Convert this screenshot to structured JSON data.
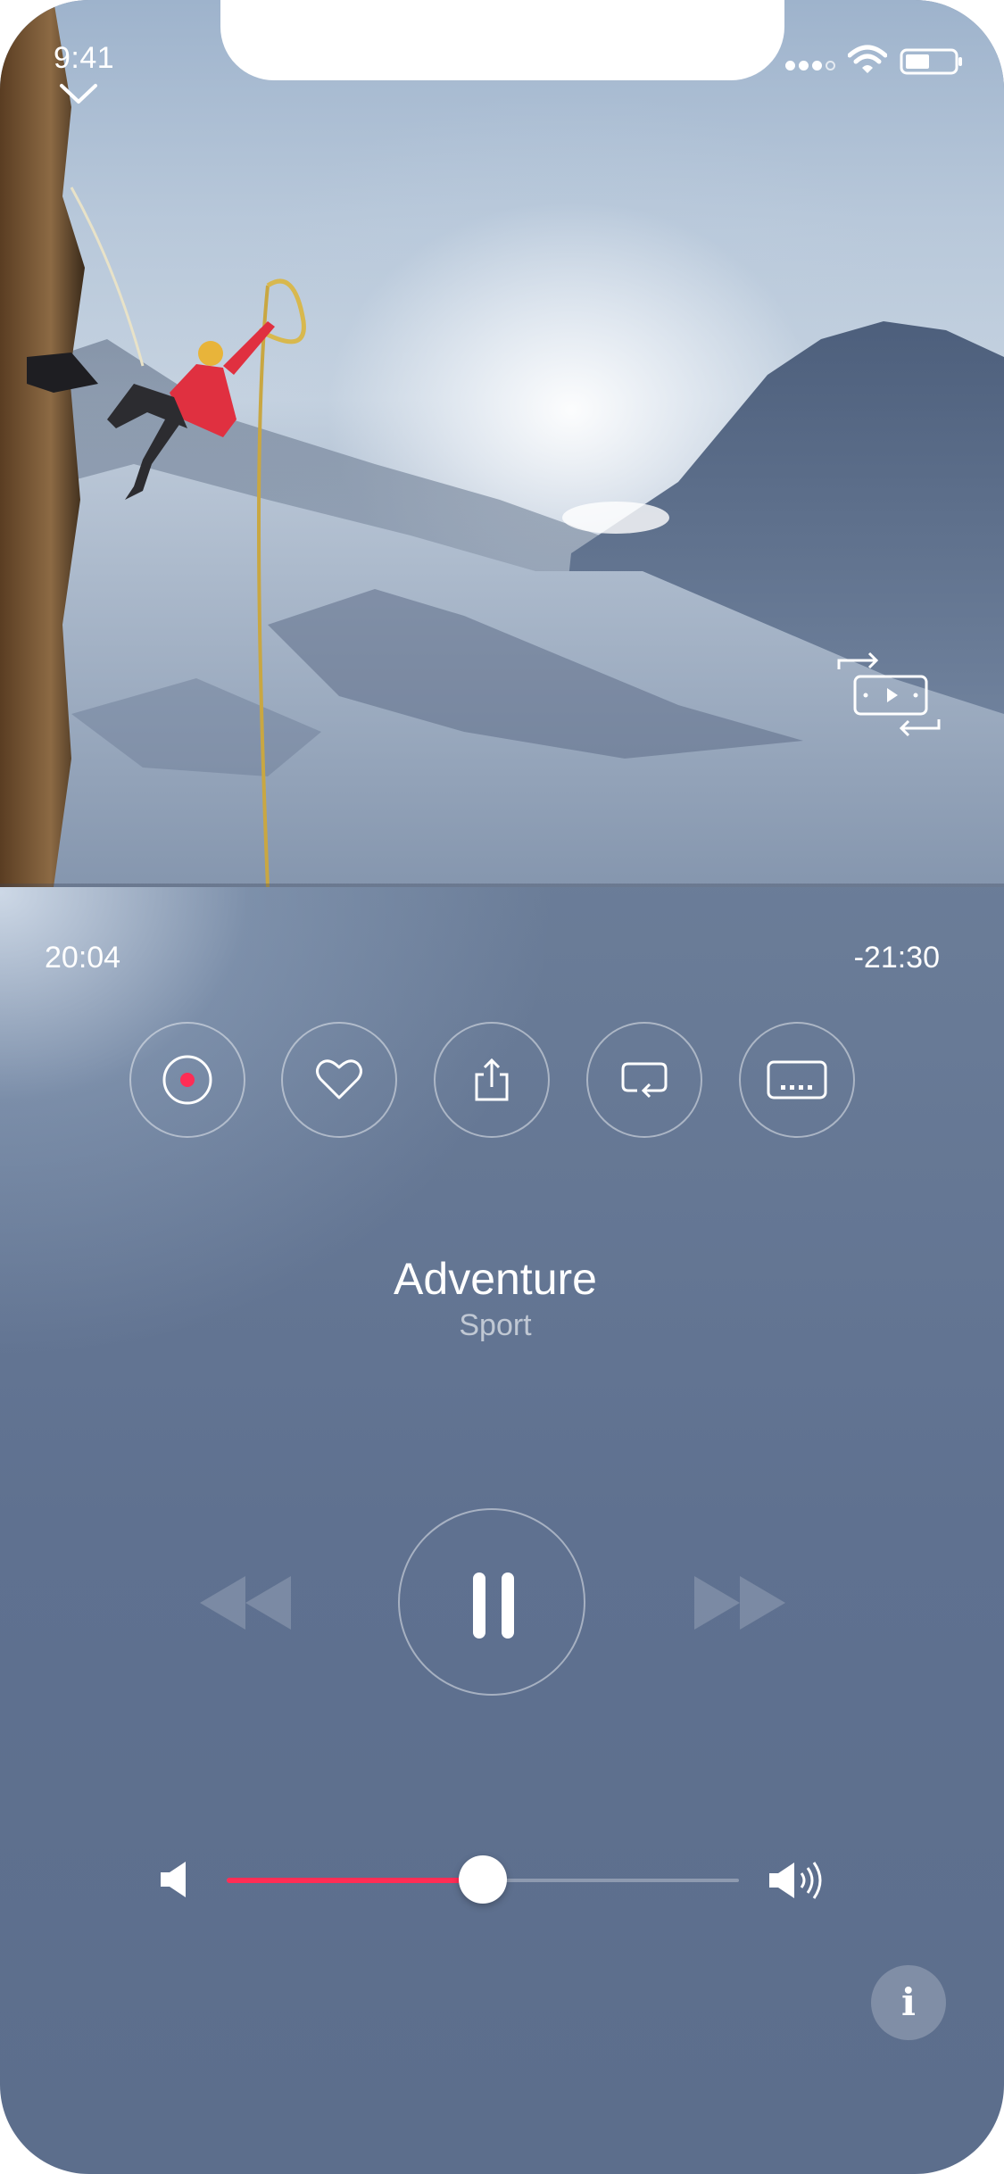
{
  "status_bar": {
    "time": "9:41",
    "icons": [
      "signal-icon",
      "wifi-icon",
      "battery-icon"
    ]
  },
  "video": {
    "image_description_icon": "climber-scene",
    "controls": [
      "collapse-chevron-icon",
      "picture-in-picture-icon"
    ]
  },
  "playback": {
    "elapsed": "20:04",
    "remaining": "-21:30",
    "volume_fraction": 0.5
  },
  "actions": [
    {
      "name": "record-button",
      "icon": "record-icon"
    },
    {
      "name": "like-button",
      "icon": "heart-icon"
    },
    {
      "name": "share-button",
      "icon": "share-icon"
    },
    {
      "name": "repeat-button",
      "icon": "repeat-icon"
    },
    {
      "name": "subtitles-button",
      "icon": "subtitles-icon"
    }
  ],
  "track": {
    "title": "Adventure",
    "category": "Sport"
  },
  "transport": {
    "icons": [
      "rewind-icon",
      "pause-icon",
      "fast-forward-icon"
    ]
  },
  "colors": {
    "accent": "#ff2d55",
    "background": "#66789a"
  },
  "info_button": {
    "label": "i"
  }
}
